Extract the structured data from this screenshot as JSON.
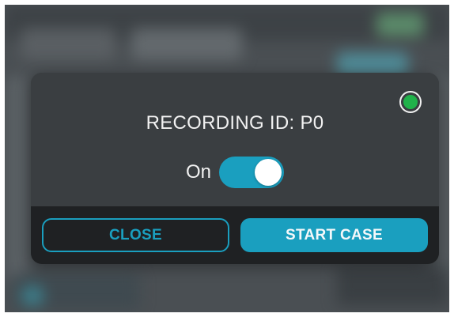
{
  "dialog": {
    "title": "RECORDING ID: P0",
    "toggle": {
      "label": "On",
      "state": "on"
    },
    "buttons": {
      "close_label": "CLOSE",
      "start_label": "START CASE"
    },
    "status_indicator": {
      "icon": "status-light-icon",
      "color": "#20b24a"
    }
  },
  "colors": {
    "accent": "#1a9fbf",
    "toggle_track": "#1a9fbf",
    "primary_button": "#1a9fbf",
    "status_ok": "#20b24a"
  }
}
